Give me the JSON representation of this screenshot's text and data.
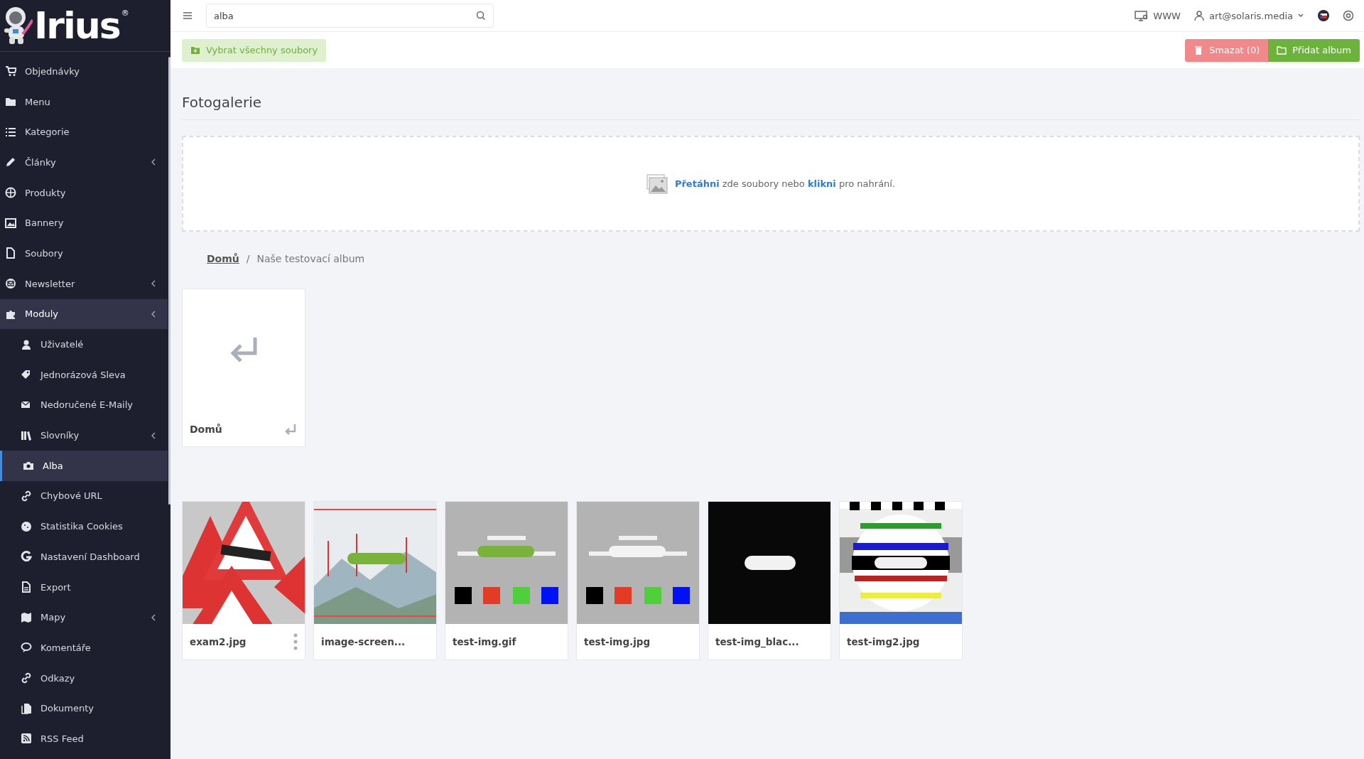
{
  "logo": {
    "text": "Irius",
    "mark": "®"
  },
  "sidebar": {
    "items": [
      {
        "label": "Objednávky",
        "kind": "link",
        "selected": false
      },
      {
        "label": "Menu",
        "kind": "link",
        "selected": false
      },
      {
        "label": "Kategorie",
        "kind": "link",
        "selected": false
      },
      {
        "label": "Články",
        "kind": "group",
        "expanded": false,
        "selected": false
      },
      {
        "label": "Produkty",
        "kind": "link",
        "selected": false
      },
      {
        "label": "Bannery",
        "kind": "link",
        "selected": false
      },
      {
        "label": "Soubory",
        "kind": "link",
        "selected": false
      },
      {
        "label": "Newsletter",
        "kind": "group",
        "expanded": false,
        "selected": false
      },
      {
        "label": "Moduly",
        "kind": "group",
        "expanded": true,
        "selected": false,
        "children": [
          {
            "label": "Uživatelé",
            "kind": "link",
            "selected": false
          },
          {
            "label": "Jednorázová Sleva",
            "kind": "link",
            "selected": false
          },
          {
            "label": "Nedoručené E-Maily",
            "kind": "link",
            "selected": false
          },
          {
            "label": "Slovníky",
            "kind": "group",
            "expanded": false,
            "selected": false
          },
          {
            "label": "Alba",
            "kind": "link",
            "selected": true
          },
          {
            "label": "Chybové URL",
            "kind": "link",
            "selected": false
          },
          {
            "label": "Statistika Cookies",
            "kind": "link",
            "selected": false
          },
          {
            "label": "Nastavení Dashboard",
            "kind": "link",
            "selected": false
          },
          {
            "label": "Export",
            "kind": "link",
            "selected": false
          },
          {
            "label": "Mapy",
            "kind": "group",
            "expanded": false,
            "selected": false
          },
          {
            "label": "Komentáře",
            "kind": "link",
            "selected": false
          },
          {
            "label": "Odkazy",
            "kind": "link",
            "selected": false
          },
          {
            "label": "Dokumenty",
            "kind": "link",
            "selected": false
          },
          {
            "label": "RSS Feed",
            "kind": "link",
            "selected": false
          }
        ]
      }
    ]
  },
  "topbar": {
    "search": {
      "value": "alba"
    },
    "site_link": "WWW",
    "user": "art@solaris.media"
  },
  "toolbar": {
    "select_all": "Vybrat všechny soubory",
    "delete": "Smazat (0)",
    "add_album": "Přidat album"
  },
  "page_title": "Fotogalerie",
  "dropzone": {
    "text": "**Přetáhni** zde soubory nebo **klikni** pro nahrání."
  },
  "breadcrumb_separator": "/",
  "breadcrumb": [
    {
      "label": "Domů",
      "kind": "link"
    },
    {
      "label": "Naše testovací album",
      "kind": "current"
    }
  ],
  "folders": [
    {
      "name": "Domů"
    }
  ],
  "files": [
    {
      "name": "exam2.jpg",
      "kind": "picture",
      "show_menu": true
    },
    {
      "name": "image-screen...",
      "kind": "picture",
      "show_menu": false
    },
    {
      "name": "test-img.gif",
      "kind": "picture",
      "show_menu": false
    },
    {
      "name": "test-img.jpg",
      "kind": "picture",
      "show_menu": false
    },
    {
      "name": "test-img_blac...",
      "kind": "picture",
      "show_menu": false
    },
    {
      "name": "test-img2.jpg",
      "kind": "picture",
      "show_menu": false
    }
  ]
}
